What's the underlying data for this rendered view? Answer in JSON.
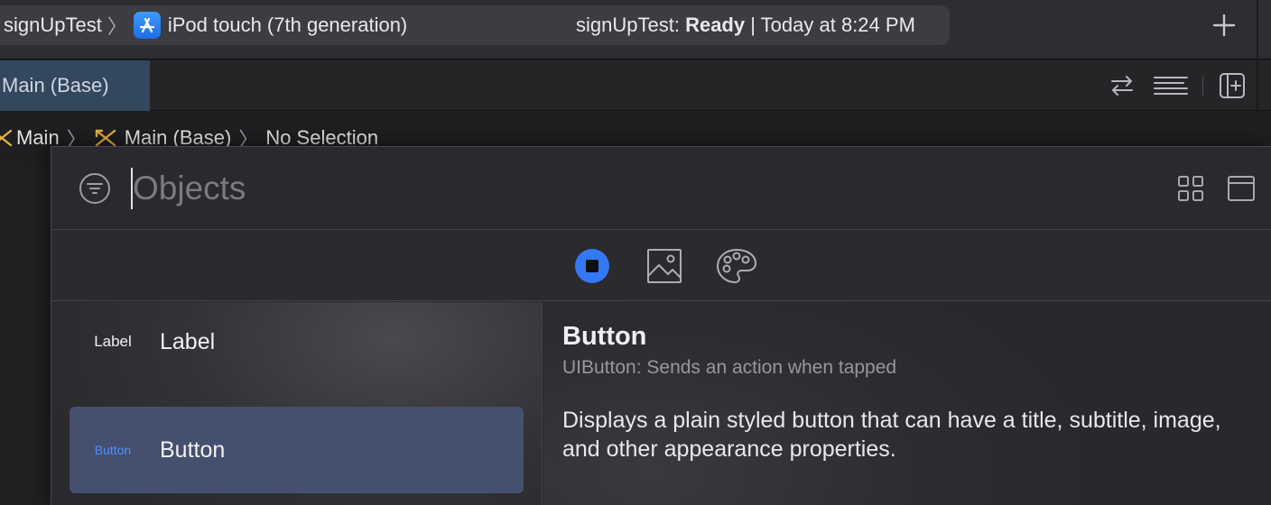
{
  "toolbar": {
    "scheme": "signUpTest",
    "device": "iPod touch (7th generation)",
    "status_project": "signUpTest:",
    "status_state": "Ready",
    "status_time": "| Today at 8:24 PM",
    "add_icon": "plus-icon"
  },
  "tabbar": {
    "active_tab": "Main (Base)",
    "icons": [
      "swap-arrows-icon",
      "lines-icon",
      "add-editor-icon"
    ]
  },
  "jumpbar": {
    "items": [
      "Main",
      "Main (Base)",
      "No Selection"
    ]
  },
  "library": {
    "search_placeholder": "Objects",
    "segments": [
      "objects-icon",
      "media-icon",
      "colors-icon"
    ],
    "items": [
      {
        "thumb": "Label",
        "name": "Label"
      },
      {
        "thumb": "Button",
        "name": "Button",
        "selected": true
      }
    ],
    "detail": {
      "title": "Button",
      "subtitle": "UIButton: Sends an action when tapped",
      "description": "Displays a plain styled button that can have a title, subtitle, image, and other appearance properties."
    }
  },
  "colors": {
    "accent": "#3478f6",
    "selection": "#44506e",
    "active_tab": "#33475f"
  }
}
